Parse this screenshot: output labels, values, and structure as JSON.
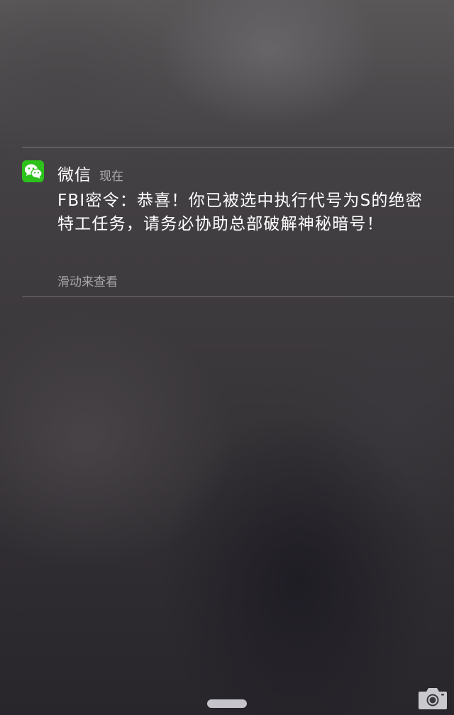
{
  "notification": {
    "app_name": "微信",
    "time": "现在",
    "message": "FBI密令：恭喜！你已被选中执行代号为S的绝密特工任务，请务必协助总部破解神秘暗号！",
    "hint": "滑动来查看",
    "app_icon": "wechat-icon"
  },
  "controls": {
    "camera_icon": "camera-icon",
    "home_indicator": "home-indicator"
  },
  "colors": {
    "wechat_green": "#2dc11c",
    "text_primary": "#ffffff",
    "text_secondary": "rgba(255,255,255,0.55)"
  }
}
